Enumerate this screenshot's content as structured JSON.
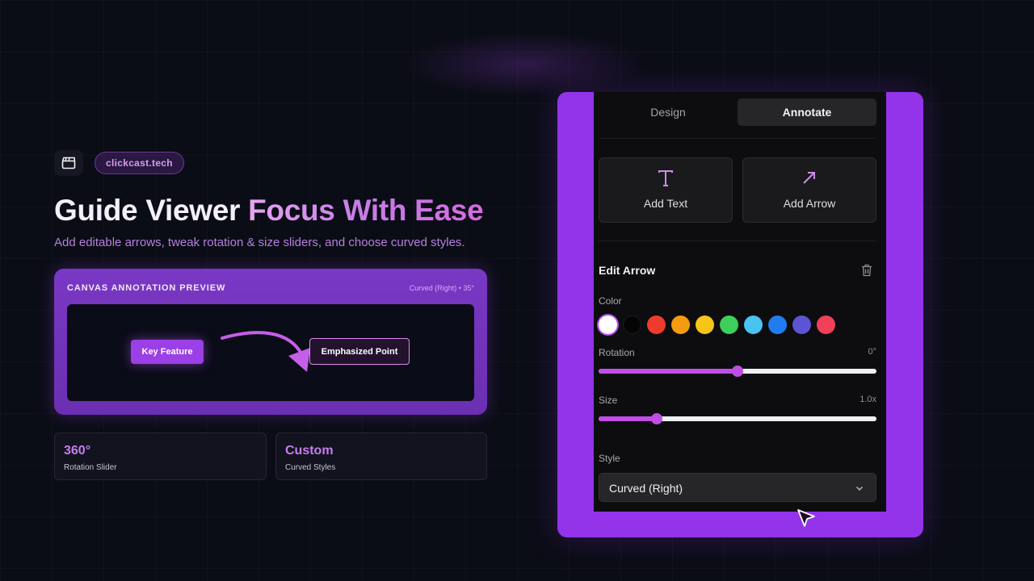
{
  "brand": {
    "logo_icon": "clapperboard-icon",
    "chip_label": "clickcast.tech"
  },
  "hero": {
    "headline_white": "Guide Viewer ",
    "headline_accent": "Focus With Ease",
    "subline": "Add editable arrows, tweak rotation & size sliders, and choose curved styles."
  },
  "preview": {
    "title": "CANVAS ANNOTATION PREVIEW",
    "meta": "Curved (Right) • 35°",
    "key_feature": "Key Feature",
    "emphasized_point": "Emphasized Point"
  },
  "stats": [
    {
      "value": "360°",
      "label": "Rotation Slider"
    },
    {
      "value": "Custom",
      "label": "Curved Styles"
    }
  ],
  "panel": {
    "tabs": [
      {
        "label": "Design",
        "active": false
      },
      {
        "label": "Annotate",
        "active": true
      }
    ],
    "tools": [
      {
        "label": "Add Text",
        "icon": "text-t-icon"
      },
      {
        "label": "Add Arrow",
        "icon": "arrow-up-right-icon"
      }
    ],
    "edit_title": "Edit Arrow",
    "color_label": "Color",
    "colors": [
      "#ffffff",
      "#050505",
      "#ef3b2c",
      "#f59b10",
      "#f5c518",
      "#3ccf5a",
      "#49c3f0",
      "#1f7df0",
      "#5d54d4",
      "#f0405a"
    ],
    "selected_color": "#ffffff",
    "rotation": {
      "label": "Rotation",
      "value": "0°",
      "fraction": 0.5
    },
    "size": {
      "label": "Size",
      "value": "1.0x",
      "fraction": 0.21
    },
    "style": {
      "label": "Style",
      "value": "Curved (Right)"
    }
  }
}
